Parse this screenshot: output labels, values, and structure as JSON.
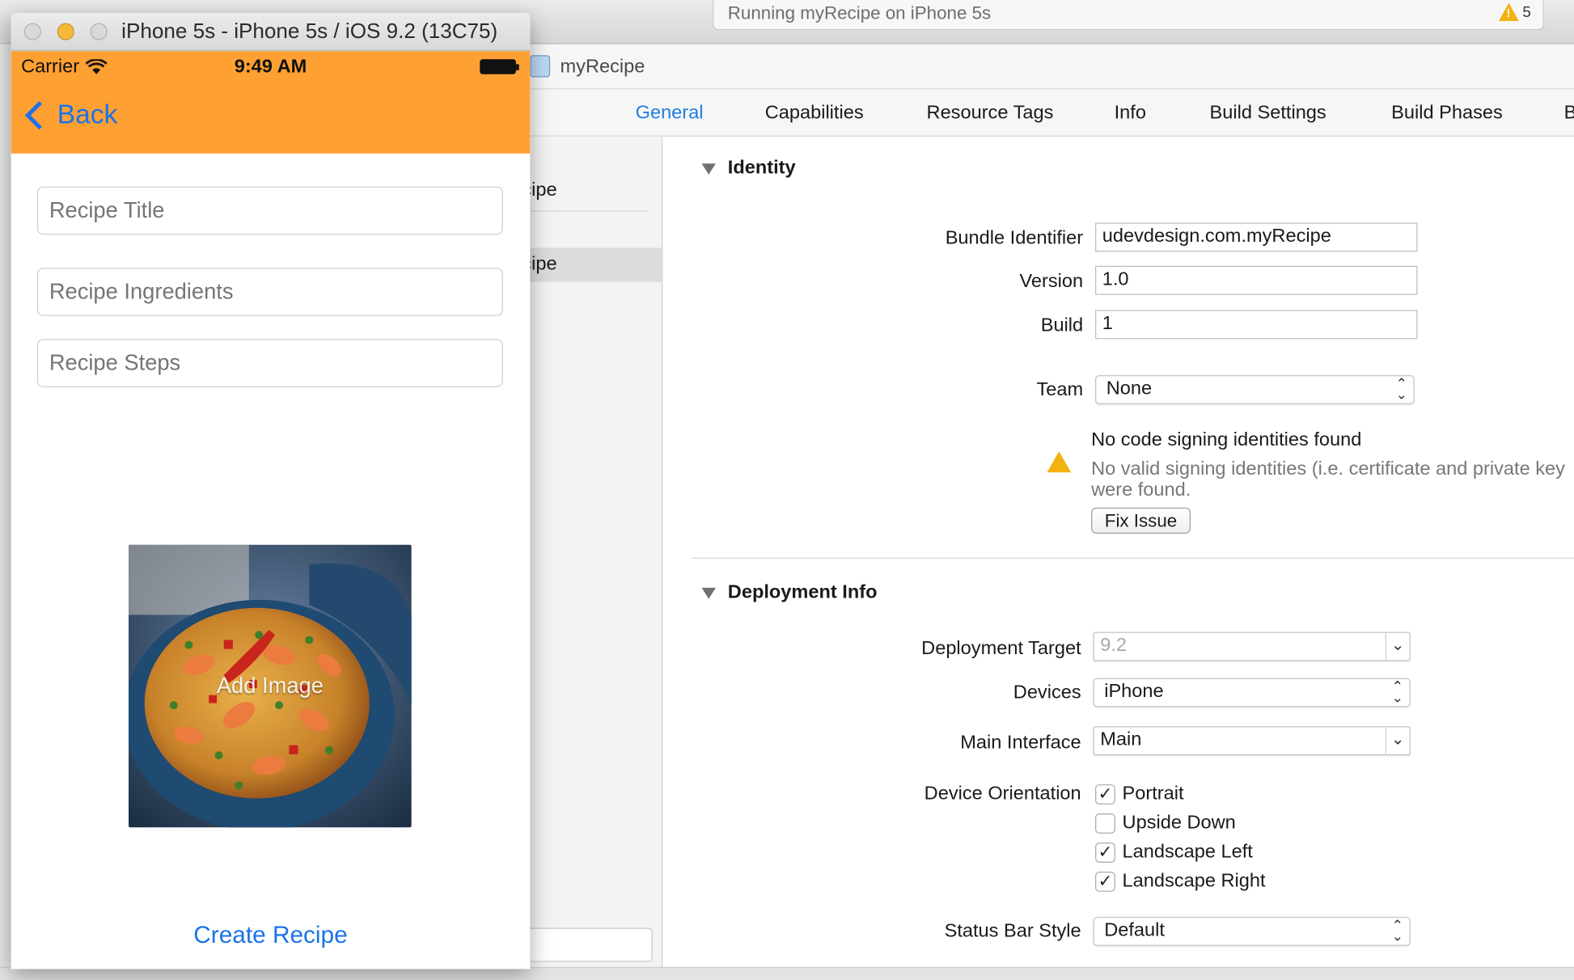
{
  "xcode": {
    "toolbar": {
      "scheme_label": "myRecipe",
      "destination_label": "iPhone 5s",
      "activity_text": "Running myRecipe on iPhone 5s",
      "warning_count": "5"
    },
    "jumpbar": {
      "project_name": "myRecipe"
    },
    "tabs": [
      {
        "label": "General",
        "active": true
      },
      {
        "label": "Capabilities"
      },
      {
        "label": "Resource Tags"
      },
      {
        "label": "Info"
      },
      {
        "label": "Build Settings"
      },
      {
        "label": "Build Phases"
      },
      {
        "label": "B"
      }
    ],
    "sidebar": {
      "items": [
        "cipe",
        "cipe"
      ]
    },
    "identity": {
      "title": "Identity",
      "bundle_identifier_label": "Bundle Identifier",
      "bundle_identifier": "udevdesign.com.myRecipe",
      "version_label": "Version",
      "version": "1.0",
      "build_label": "Build",
      "build": "1",
      "team_label": "Team",
      "team": "None",
      "signing_warning_title": "No code signing identities found",
      "signing_warning_line1": "No valid signing identities (i.e. certificate and private key",
      "signing_warning_line2": "were found.",
      "fix_issue_label": "Fix Issue"
    },
    "deployment": {
      "title": "Deployment Info",
      "target_label": "Deployment Target",
      "target": "9.2",
      "devices_label": "Devices",
      "devices": "iPhone",
      "main_interface_label": "Main Interface",
      "main_interface": "Main",
      "orientation_label": "Device Orientation",
      "orientations": [
        {
          "label": "Portrait",
          "checked": true
        },
        {
          "label": "Upside Down",
          "checked": false
        },
        {
          "label": "Landscape Left",
          "checked": true
        },
        {
          "label": "Landscape Right",
          "checked": true
        }
      ],
      "status_bar_label": "Status Bar Style",
      "status_bar": "Default"
    },
    "check_glyph": "✓"
  },
  "simulator": {
    "title": "iPhone 5s - iPhone 5s / iOS 9.2 (13C75)",
    "status_bar": {
      "carrier": "Carrier",
      "time": "9:49 AM"
    },
    "nav": {
      "back_label": "Back",
      "bar_color": "#ffa033"
    },
    "form": {
      "title_placeholder": "Recipe Title",
      "ingredients_placeholder": "Recipe Ingredients",
      "steps_placeholder": "Recipe Steps"
    },
    "image_button_label": "Add Image",
    "create_button_label": "Create Recipe"
  },
  "colors": {
    "accent_blue": "#1a73e8",
    "xcode_tab_active": "#1f7ee0",
    "warning_yellow": "#f2b20f"
  }
}
